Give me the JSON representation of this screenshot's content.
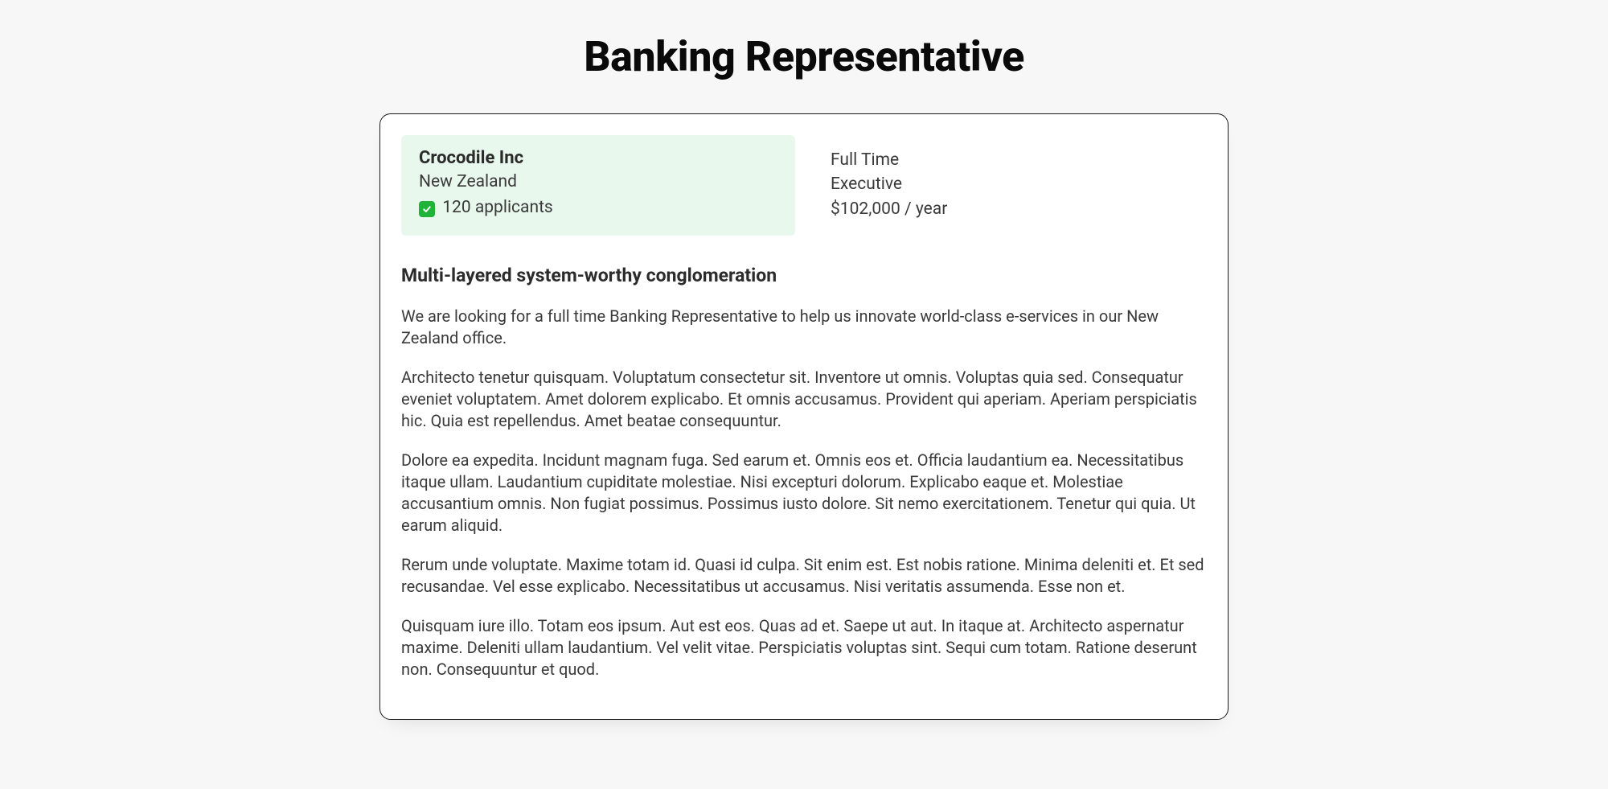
{
  "title": "Banking Representative",
  "meta": {
    "company": "Crocodile Inc",
    "location": "New Zealand",
    "applicants_text": "120 applicants",
    "employment_type": "Full Time",
    "seniority": "Executive",
    "salary": "$102,000 / year"
  },
  "description": {
    "heading": "Multi-layered system-worthy conglomeration",
    "paragraphs": [
      "We are looking for a full time Banking Representative to help us innovate world-class e-services in our New Zealand office.",
      "Architecto tenetur quisquam. Voluptatum consectetur sit. Inventore ut omnis. Voluptas quia sed. Consequatur eveniet voluptatem. Amet dolorem explicabo. Et omnis accusamus. Provident qui aperiam. Aperiam perspiciatis hic. Quia est repellendus. Amet beatae consequuntur.",
      "Dolore ea expedita. Incidunt magnam fuga. Sed earum et. Omnis eos et. Officia laudantium ea. Necessitatibus itaque ullam. Laudantium cupiditate molestiae. Nisi excepturi dolorum. Explicabo eaque et. Molestiae accusantium omnis. Non fugiat possimus. Possimus iusto dolore. Sit nemo exercitationem. Tenetur qui quia. Ut earum aliquid.",
      "Rerum unde voluptate. Maxime totam id. Quasi id culpa. Sit enim est. Est nobis ratione. Minima deleniti et. Et sed recusandae. Vel esse explicabo. Necessitatibus ut accusamus. Nisi veritatis assumenda. Esse non et.",
      "Quisquam iure illo. Totam eos ipsum. Aut est eos. Quas ad et. Saepe ut aut. In itaque at. Architecto aspernatur maxime. Deleniti ullam laudantium. Vel velit vitae. Perspiciatis voluptas sint. Sequi cum totam. Ratione deserunt non. Consequuntur et quod."
    ]
  }
}
